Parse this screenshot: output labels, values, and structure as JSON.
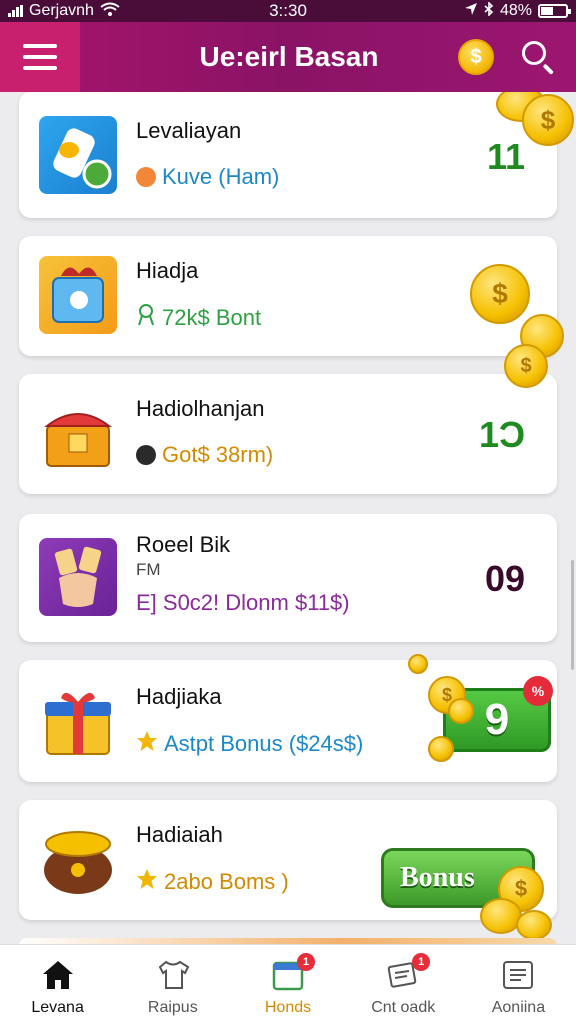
{
  "status": {
    "carrier": "Gerjavnh",
    "time": "3::30",
    "battery": "48%",
    "battery_level": 0.48
  },
  "header": {
    "title": "Ue:eirl Basan",
    "coin_symbol": "$"
  },
  "cards": [
    {
      "title": "Levaliayan",
      "subtitle": "Kuve (Ham)",
      "subtitle_color": "#1b88c9",
      "sub_icon": "orange-badge-icon",
      "count": "11",
      "count_color": "#1f8a1f",
      "thumb_icon": "mug-app-icon"
    },
    {
      "title": "Hiadja",
      "subtitle": "72k$ Bont",
      "subtitle_color": "#2ea043",
      "sub_icon": "ribbon-icon",
      "count": "",
      "count_color": "#1f8a1f",
      "thumb_icon": "gift-bag-icon"
    },
    {
      "title": "Hadiolhanjan",
      "subtitle": "Got$ 38rm)",
      "subtitle_color": "#d48a00",
      "sub_icon": "face-icon",
      "count": "1Ɔ",
      "count_color": "#1f8a1f",
      "thumb_icon": "treasure-chest-icon"
    },
    {
      "title": "Roeel Bik",
      "title_extra": "FM",
      "subtitle": "E] S0c2! Dlonm $11$)",
      "subtitle_color": "#8a2a9c",
      "sub_icon": "",
      "count": "09",
      "count_color": "#3a0a2a",
      "thumb_icon": "hands-app-icon"
    },
    {
      "title": "Hadjiaka",
      "subtitle": "Astpt Bonus ($24s$)",
      "subtitle_color": "#1b88c9",
      "sub_icon": "star-icon",
      "count": "9",
      "count_color": "#ffffff",
      "thumb_icon": "gift-box-icon",
      "badge_pct": "%"
    },
    {
      "title": "Hadiaiah",
      "subtitle": "2abo Boms )",
      "subtitle_color": "#d48a00",
      "sub_icon": "star-icon",
      "count": "",
      "count_color": "#1f8a1f",
      "thumb_icon": "pot-icon",
      "button_label": "Bonus"
    }
  ],
  "nav": [
    {
      "label": "Levana",
      "icon": "home-icon"
    },
    {
      "label": "Raipus",
      "icon": "shirt-icon"
    },
    {
      "label": "Honds",
      "icon": "tablet-icon",
      "badge": "1"
    },
    {
      "label": "Cnt oadk",
      "icon": "cards-icon",
      "badge": "1"
    },
    {
      "label": "Aoniina",
      "icon": "list-icon"
    }
  ]
}
